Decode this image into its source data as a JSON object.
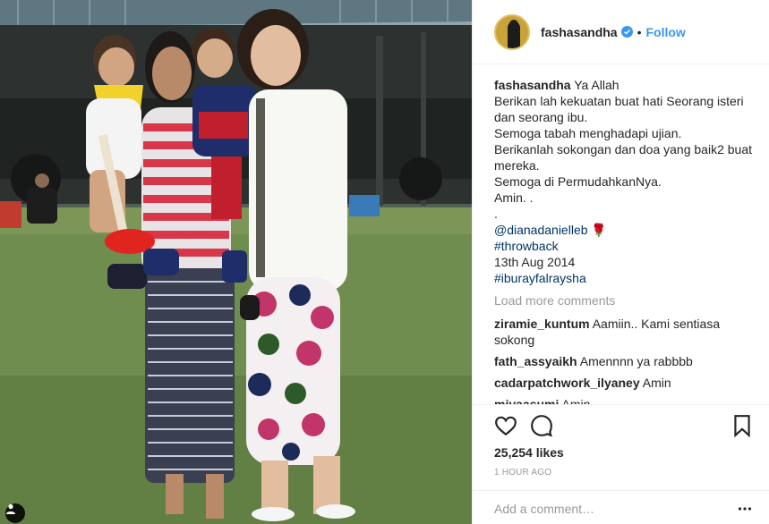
{
  "post": {
    "username": "fashasandha",
    "verified": true,
    "follow_label": "Follow",
    "separator": "•"
  },
  "caption": {
    "username": "fashasandha",
    "lines": [
      "Ya Allah",
      "Berikan lah kekuatan buat hati Seorang isteri dan seorang ibu.",
      "Semoga tabah menghadapi ujian.",
      "Berikanlah sokongan dan doa yang baik2 buat mereka.",
      "Semoga di PermudahkanNya.",
      "Amin. .",
      "."
    ],
    "mention": "@dianadanielleb",
    "mention_emoji": "🌹",
    "hashtag1": "#throwback",
    "date": "13th Aug 2014",
    "hashtag2": "#iburayfalraysha"
  },
  "load_more_label": "Load more comments",
  "comments": [
    {
      "username": "ziramie_kuntum",
      "text": "Aamiin.. Kami sentiasa sokong"
    },
    {
      "username": "fath_assyaikh",
      "text": "Amennnn ya rabbbb"
    },
    {
      "username": "cadarpatchwork_ilyaney",
      "text": "Amin"
    },
    {
      "username": "miyaasumi",
      "text": "Amin"
    }
  ],
  "likes_label": "25,254 likes",
  "time_label": "1 HOUR AGO",
  "add_comment_placeholder": "Add a comment…",
  "icons": {
    "like": "heart-icon",
    "comment": "speech-bubble-icon",
    "save": "bookmark-icon",
    "more": "ellipsis-icon",
    "tag": "person-tag-icon",
    "verified": "verified-badge-icon"
  },
  "colors": {
    "link": "#003569",
    "follow": "#3897f0",
    "muted": "#999999",
    "text": "#262626",
    "verified": "#3897f0"
  }
}
